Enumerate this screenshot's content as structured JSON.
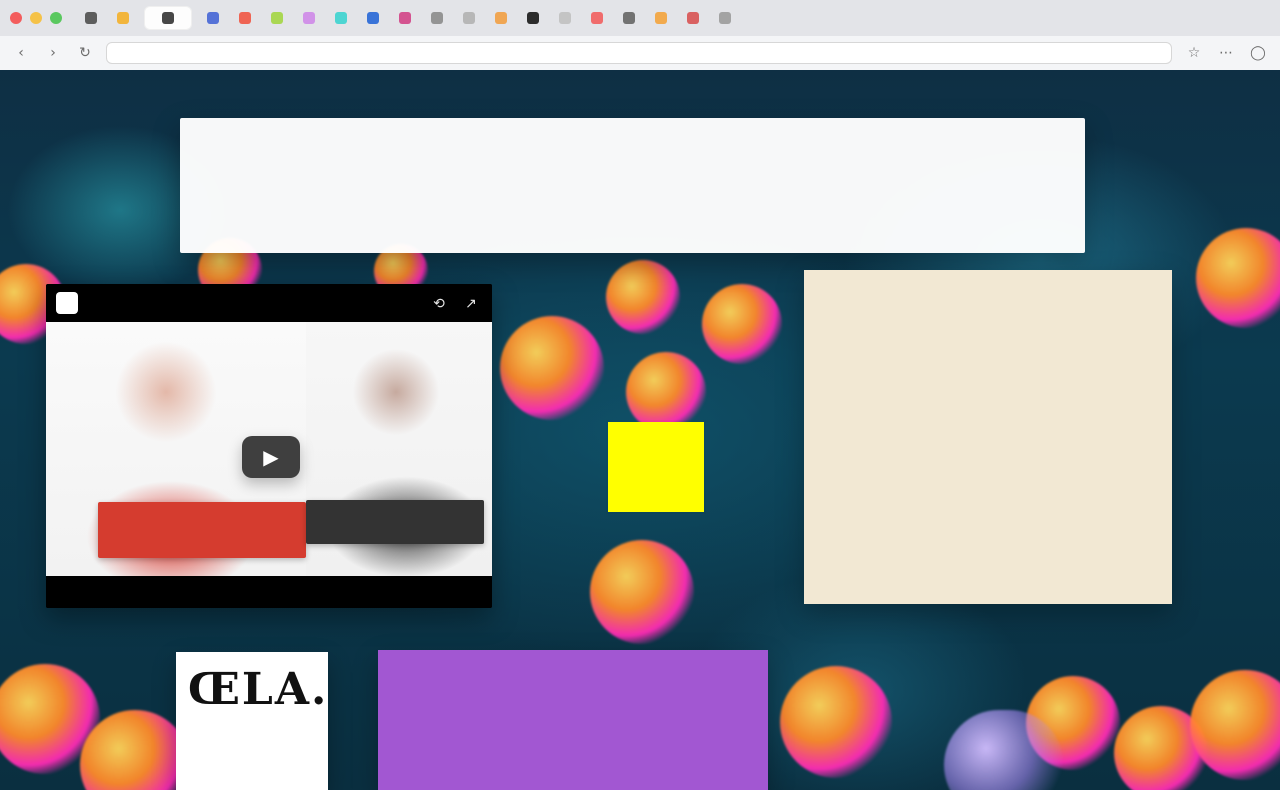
{
  "browser": {
    "address_bar_text": "",
    "tabs": [
      {
        "fav_color": "#555555"
      },
      {
        "fav_color": "#f2b233"
      },
      {
        "fav_color": "#3f3f3f"
      },
      {
        "fav_color": "#4d6bd6"
      },
      {
        "fav_color": "#ef5d4b"
      },
      {
        "fav_color": "#a7d64b"
      },
      {
        "fav_color": "#d08de8"
      },
      {
        "fav_color": "#45d4d1"
      },
      {
        "fav_color": "#2f6dd7"
      },
      {
        "fav_color": "#d34b8b"
      },
      {
        "fav_color": "#8f8f8f"
      },
      {
        "fav_color": "#b4b4b4"
      },
      {
        "fav_color": "#f0a24b"
      },
      {
        "fav_color": "#222222"
      },
      {
        "fav_color": "#c2c2c2"
      },
      {
        "fav_color": "#f06565"
      },
      {
        "fav_color": "#6c6c6c"
      },
      {
        "fav_color": "#f2a645"
      },
      {
        "fav_color": "#d85a5a"
      },
      {
        "fav_color": "#9f9f9f"
      }
    ],
    "toolbar": {
      "back_icon": "chevron-left-icon",
      "forward_icon": "chevron-right-icon",
      "reload_icon": "reload-icon",
      "right_icons": [
        "star-icon",
        "extensions-icon",
        "profile-icon"
      ]
    }
  },
  "canvas": {
    "note": {
      "text": "",
      "meta": ""
    },
    "video": {
      "title": "",
      "avatar_label": "",
      "play_icon": "play-icon",
      "actions": [
        "clock-icon",
        "share-icon"
      ]
    },
    "beige_note": {
      "text": ""
    },
    "logo_card": {
      "text": "ŒLA."
    },
    "purple_card": {
      "text": ""
    }
  }
}
